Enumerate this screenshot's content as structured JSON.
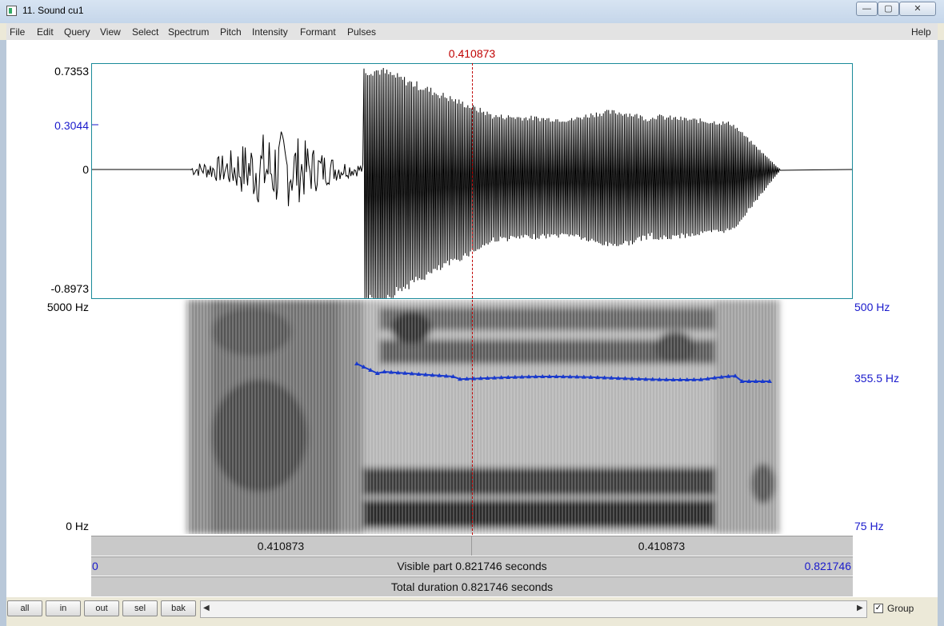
{
  "window": {
    "title": "11. Sound cu1",
    "minimize_icon": "minimize-icon",
    "maximize_icon": "maximize-icon",
    "close_icon": "close-icon"
  },
  "menu": [
    "File",
    "Edit",
    "Query",
    "View",
    "Select",
    "Spectrum",
    "Pitch",
    "Intensity",
    "Formant",
    "Pulses"
  ],
  "help": "Help",
  "cursor_time": "0.410873",
  "waveform": {
    "ymax": "0.7353",
    "ymark": "0.3044",
    "zero": "0",
    "ymin": "-0.8973"
  },
  "spectrogram": {
    "fmax": "5000 Hz",
    "fmin": "0 Hz",
    "pitch_max": "500 Hz",
    "pitch_cursor": "355.5 Hz",
    "pitch_min": "75 Hz"
  },
  "bars": {
    "left_time": "0.410873",
    "right_time": "0.410873",
    "visible_start": "0",
    "visible_part": "Visible part 0.821746 seconds",
    "visible_end": "0.821746",
    "total": "Total duration 0.821746 seconds"
  },
  "buttons": [
    "all",
    "in",
    "out",
    "sel",
    "bak"
  ],
  "group": {
    "label": "Group",
    "checked": true
  },
  "colors": {
    "cursor": "#c00000",
    "pitch": "#1a3acc",
    "axis_blue": "#1a1acc"
  }
}
